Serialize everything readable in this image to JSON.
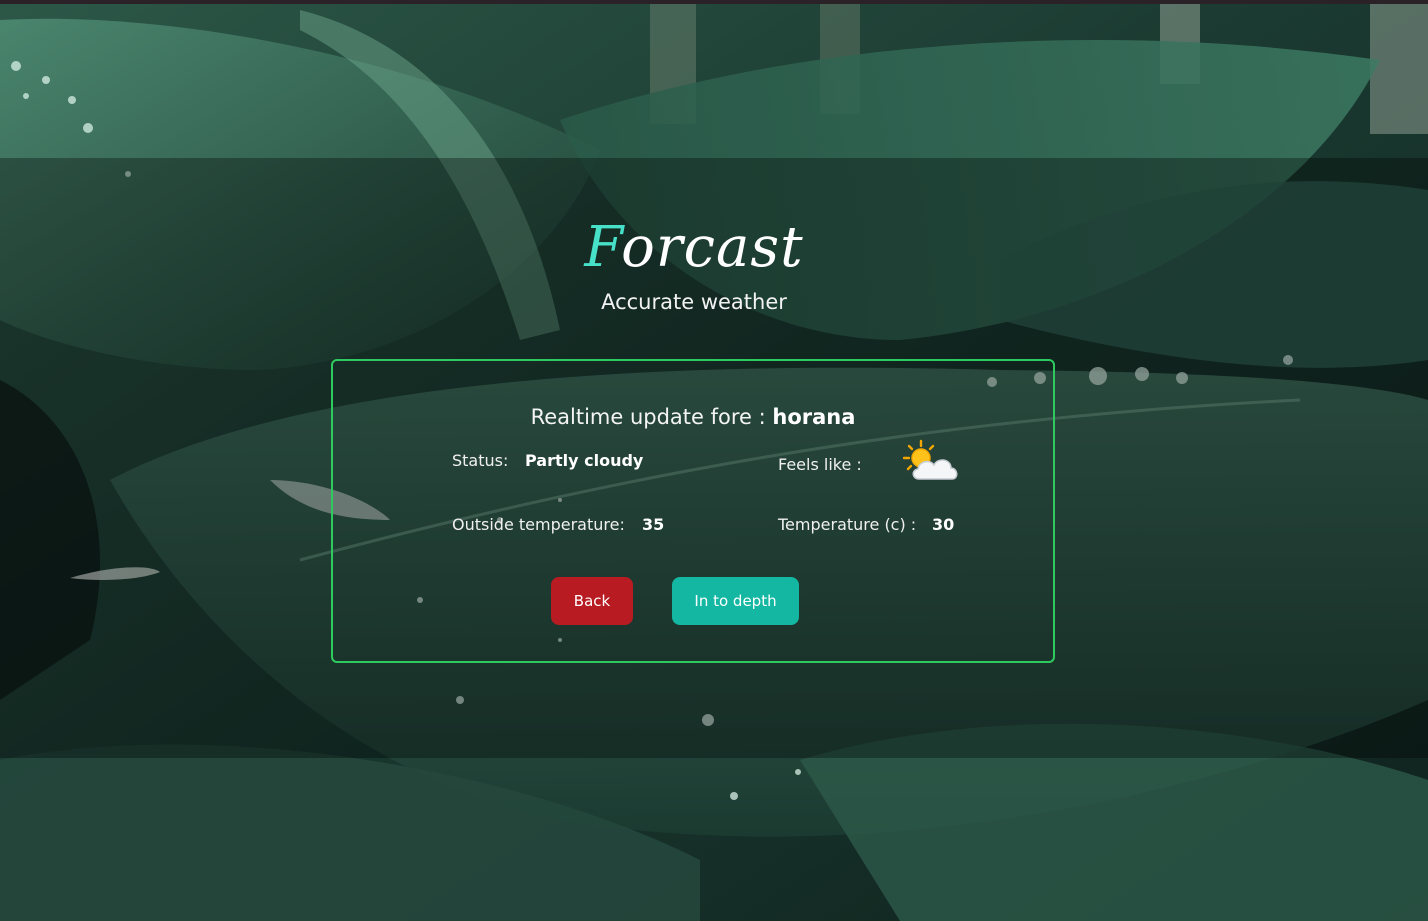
{
  "header": {
    "brand_first_letter": "F",
    "brand_rest": "orcast",
    "tagline": "Accurate weather"
  },
  "card": {
    "title_prefix": "Realtime update fore : ",
    "location": "horana",
    "status_label": "Status:",
    "status_value": "Partly cloudy",
    "feels_like_label": "Feels like :",
    "feels_like_icon": "partly-cloudy-icon",
    "outside_temp_label": "Outside temperature:",
    "outside_temp_value": "35",
    "temp_c_label": "Temperature (c) :",
    "temp_c_value": "30"
  },
  "buttons": {
    "back": "Back",
    "in_depth": "In to depth"
  },
  "colors": {
    "accent": "#47e0c8",
    "card_border": "#2fca5f",
    "back_button": "#b81b22",
    "depth_button": "#13b7a2"
  }
}
